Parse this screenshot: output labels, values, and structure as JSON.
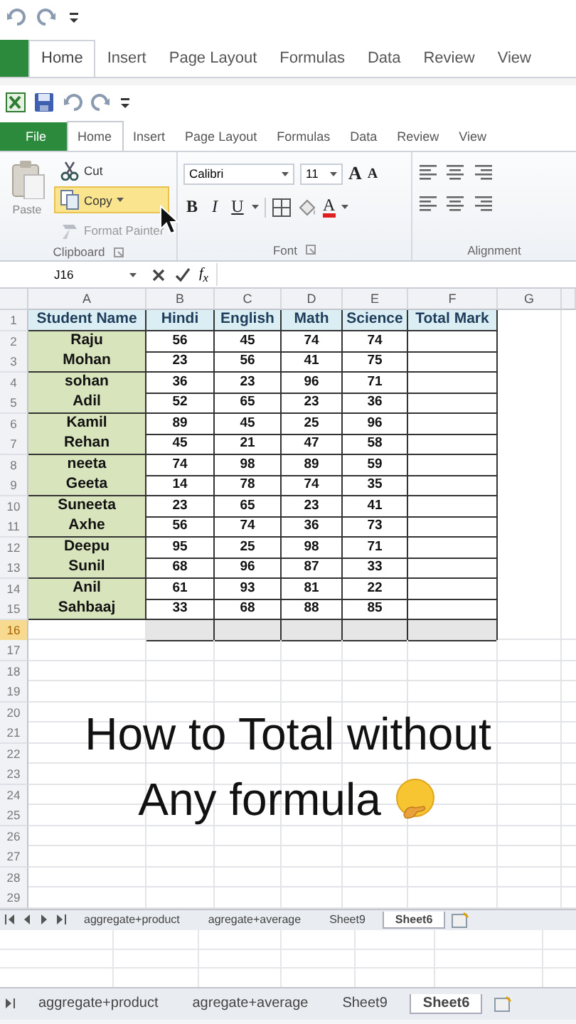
{
  "back_window": {
    "tabs": [
      {
        "label": "Home",
        "selected": true
      },
      {
        "label": "Insert",
        "selected": false
      },
      {
        "label": "Page Layout",
        "selected": false
      },
      {
        "label": "Formulas",
        "selected": false
      },
      {
        "label": "Data",
        "selected": false
      },
      {
        "label": "Review",
        "selected": false
      },
      {
        "label": "View",
        "selected": false
      }
    ],
    "sheet_tabs": [
      {
        "label": "aggregate+product",
        "selected": false
      },
      {
        "label": "agregate+average",
        "selected": false
      },
      {
        "label": "Sheet9",
        "selected": false
      },
      {
        "label": "Sheet6",
        "selected": true
      }
    ]
  },
  "window": {
    "tabs": [
      {
        "label": "File",
        "kind": "file",
        "selected": false
      },
      {
        "label": "Home",
        "kind": "tab",
        "selected": true
      },
      {
        "label": "Insert",
        "kind": "tab",
        "selected": false
      },
      {
        "label": "Page Layout",
        "kind": "tab",
        "selected": false
      },
      {
        "label": "Formulas",
        "kind": "tab",
        "selected": false
      },
      {
        "label": "Data",
        "kind": "tab",
        "selected": false
      },
      {
        "label": "Review",
        "kind": "tab",
        "selected": false
      },
      {
        "label": "View",
        "kind": "tab",
        "selected": false
      }
    ],
    "ribbon": {
      "groups": [
        {
          "kind": "clipboard",
          "label": "Clipboard",
          "paste": "Paste",
          "items": [
            {
              "kind": "cut",
              "label": "Cut",
              "highlighted": false
            },
            {
              "kind": "copy",
              "label": "Copy",
              "highlighted": true
            },
            {
              "kind": "format_painter",
              "label": "Format Painter",
              "highlighted": false
            }
          ]
        },
        {
          "kind": "font",
          "label": "Font",
          "font_name": "Calibri",
          "font_size": "11",
          "size_buttons": [
            "A",
            "A"
          ],
          "style_buttons": [
            "B",
            "I",
            "U"
          ],
          "color_button": "A"
        },
        {
          "kind": "alignment",
          "label": "Alignment"
        }
      ]
    },
    "formula_bar": {
      "name_box": "J16",
      "function_label": "f$_{x}$"
    },
    "sheet": {
      "columns": [
        "A",
        "B",
        "C",
        "D",
        "E",
        "F",
        "G"
      ],
      "rows": [
        {
          "number": "1",
          "kind": "header",
          "selected": false,
          "cells": [
            "Student Name",
            "Hindi",
            "English",
            "Math",
            "Science",
            "Total Mark"
          ]
        },
        {
          "number": "2",
          "kind": "data",
          "selected": false,
          "cells": [
            "Raju",
            "56",
            "45",
            "74",
            "74",
            ""
          ]
        },
        {
          "number": "3",
          "kind": "data",
          "selected": false,
          "cells": [
            "Mohan",
            "23",
            "56",
            "41",
            "75",
            ""
          ]
        },
        {
          "number": "4",
          "kind": "data",
          "selected": false,
          "cells": [
            "sohan",
            "36",
            "23",
            "96",
            "71",
            ""
          ]
        },
        {
          "number": "5",
          "kind": "data",
          "selected": false,
          "cells": [
            "Adil",
            "52",
            "65",
            "23",
            "36",
            ""
          ]
        },
        {
          "number": "6",
          "kind": "data",
          "selected": false,
          "cells": [
            "Kamil",
            "89",
            "45",
            "25",
            "96",
            ""
          ]
        },
        {
          "number": "7",
          "kind": "data",
          "selected": false,
          "cells": [
            "Rehan",
            "45",
            "21",
            "47",
            "58",
            ""
          ]
        },
        {
          "number": "8",
          "kind": "data",
          "selected": false,
          "cells": [
            "neeta",
            "74",
            "98",
            "89",
            "59",
            ""
          ]
        },
        {
          "number": "9",
          "kind": "data",
          "selected": false,
          "cells": [
            "Geeta",
            "14",
            "78",
            "74",
            "35",
            ""
          ]
        },
        {
          "number": "10",
          "kind": "data",
          "selected": false,
          "cells": [
            "Suneeta",
            "23",
            "65",
            "23",
            "41",
            ""
          ]
        },
        {
          "number": "11",
          "kind": "data",
          "selected": false,
          "cells": [
            "Axhe",
            "56",
            "74",
            "36",
            "73",
            ""
          ]
        },
        {
          "number": "12",
          "kind": "data",
          "selected": false,
          "cells": [
            "Deepu",
            "95",
            "25",
            "98",
            "71",
            ""
          ]
        },
        {
          "number": "13",
          "kind": "data",
          "selected": false,
          "cells": [
            "Sunil",
            "68",
            "96",
            "87",
            "33",
            ""
          ]
        },
        {
          "number": "14",
          "kind": "data",
          "selected": false,
          "cells": [
            "Anil",
            "61",
            "93",
            "81",
            "22",
            ""
          ]
        },
        {
          "number": "15",
          "kind": "data",
          "selected": false,
          "cells": [
            "Sahbaaj",
            "33",
            "68",
            "88",
            "85",
            ""
          ]
        },
        {
          "number": "16",
          "kind": "total",
          "selected": true
        },
        {
          "number": "17",
          "kind": "empty",
          "selected": false
        },
        {
          "number": "18",
          "kind": "empty",
          "selected": false
        },
        {
          "number": "19",
          "kind": "empty",
          "selected": false
        },
        {
          "number": "20",
          "kind": "empty",
          "selected": false
        },
        {
          "number": "21",
          "kind": "empty",
          "selected": false
        },
        {
          "number": "22",
          "kind": "empty",
          "selected": false
        },
        {
          "number": "23",
          "kind": "empty",
          "selected": false
        },
        {
          "number": "24",
          "kind": "empty",
          "selected": false
        },
        {
          "number": "25",
          "kind": "empty",
          "selected": false
        },
        {
          "number": "26",
          "kind": "empty",
          "selected": false
        },
        {
          "number": "27",
          "kind": "empty",
          "selected": false
        },
        {
          "number": "28",
          "kind": "empty",
          "selected": false
        },
        {
          "number": "29",
          "kind": "empty",
          "selected": false
        }
      ]
    },
    "sheet_tabs": [
      {
        "label": "aggregate+product",
        "selected": false
      },
      {
        "label": "agregate+average",
        "selected": false
      },
      {
        "label": "Sheet9",
        "selected": false
      },
      {
        "label": "Sheet6",
        "selected": true
      }
    ]
  },
  "caption": {
    "lines": [
      "How to Total without",
      "Any formula"
    ]
  }
}
